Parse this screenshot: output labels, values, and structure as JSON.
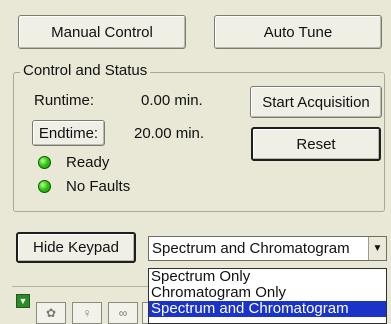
{
  "tabs": {
    "manual_control": "Manual Control",
    "auto_tune": "Auto Tune"
  },
  "control_status": {
    "title": "Control and Status",
    "runtime_label": "Runtime:",
    "runtime_value": "0.00 min.",
    "endtime_label": "Endtime:",
    "endtime_value": "20.00 min.",
    "ready_label": "Ready",
    "faults_label": "No Faults",
    "start_acquisition": "Start Acquisition",
    "reset": "Reset"
  },
  "keypad": {
    "hide_label": "Hide Keypad"
  },
  "view_select": {
    "selected": "Spectrum and Chromatogram",
    "options": [
      "Spectrum Only",
      "Chromatogram Only",
      "Spectrum and Chromatogram"
    ]
  },
  "colors": {
    "background": "#e9e7d6",
    "led_green": "#35c814",
    "highlight": "#1a33c8"
  }
}
